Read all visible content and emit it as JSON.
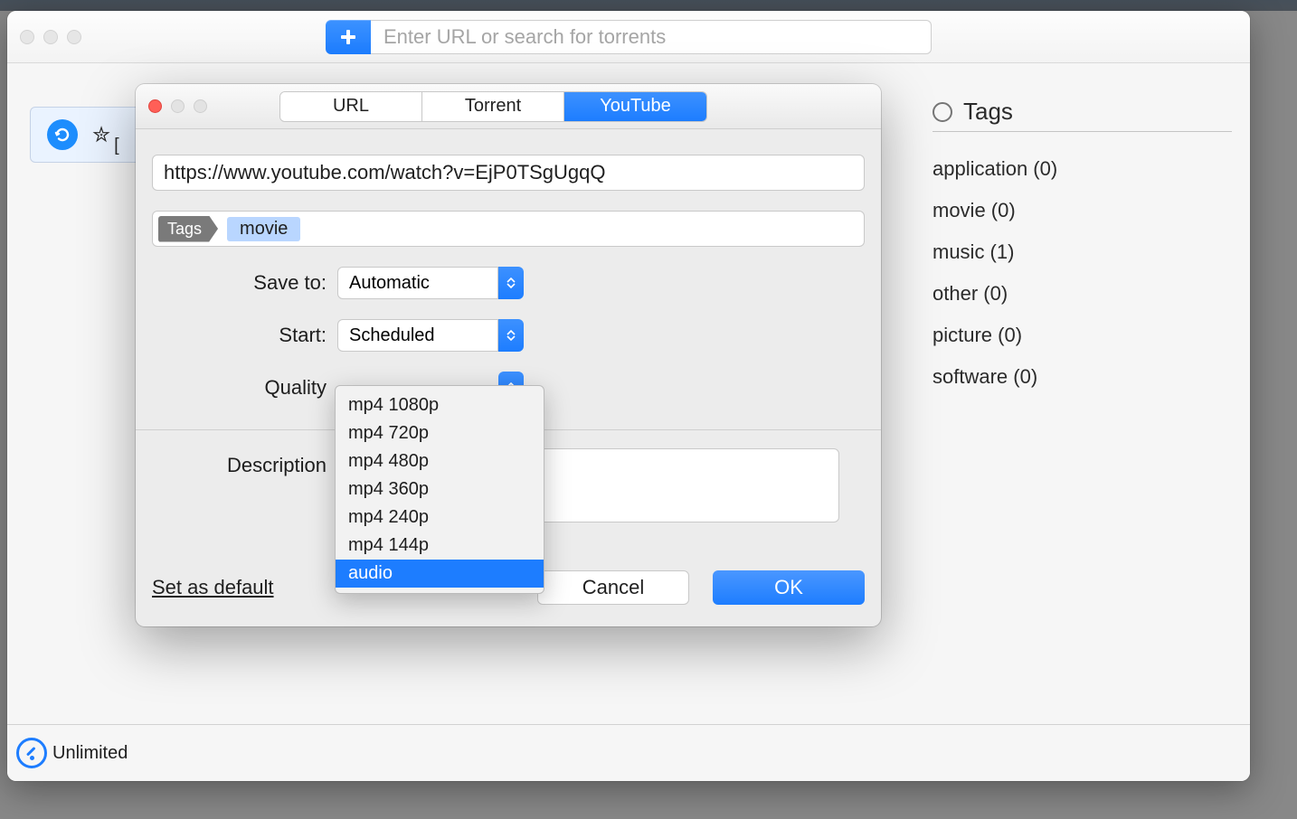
{
  "toolbar": {
    "search_placeholder": "Enter URL or search for torrents"
  },
  "download_row": {
    "star_glyph": "✮",
    "bracket_glyph": "["
  },
  "sidebar": {
    "title": "Tags",
    "tags": [
      {
        "label": "application (0)"
      },
      {
        "label": "movie (0)"
      },
      {
        "label": "music (1)"
      },
      {
        "label": "other (0)"
      },
      {
        "label": "picture (0)"
      },
      {
        "label": "software (0)"
      }
    ]
  },
  "footer": {
    "speed_label": "Unlimited"
  },
  "dialog": {
    "tabs": [
      "URL",
      "Torrent",
      "YouTube"
    ],
    "active_tab": "YouTube",
    "url_value": "https://www.youtube.com/watch?v=EjP0TSgUgqQ",
    "tags_label": "Tags",
    "tag_chip": "movie",
    "save_to": {
      "label": "Save to:",
      "value": "Automatic"
    },
    "start": {
      "label": "Start:",
      "value": "Scheduled"
    },
    "quality": {
      "label": "Quality"
    },
    "description_label": "Description",
    "set_default": "Set as default",
    "cancel": "Cancel",
    "ok": "OK"
  },
  "quality_options": [
    "mp4 1080p",
    "mp4 720p",
    "mp4 480p",
    "mp4 360p",
    "mp4 240p",
    "mp4 144p",
    "audio"
  ],
  "quality_selected": "audio"
}
